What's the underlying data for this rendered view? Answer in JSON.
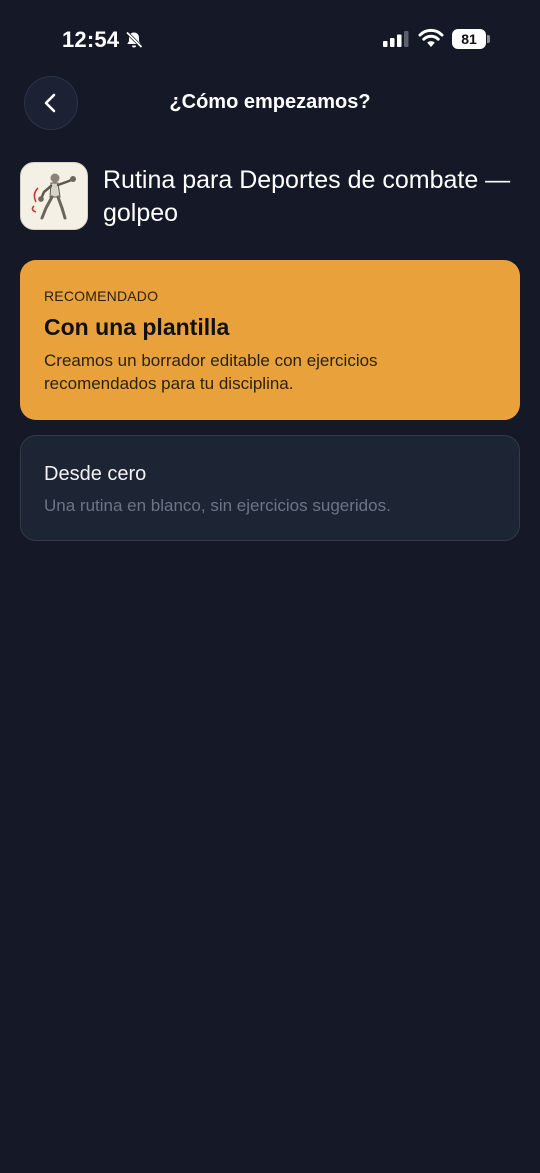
{
  "status_bar": {
    "time": "12:54",
    "battery": "81",
    "icons": [
      "bell-muted-icon",
      "signal-icon",
      "wifi-icon",
      "battery-icon"
    ]
  },
  "header": {
    "title": "¿Cómo empezamos?",
    "back_icon": "chevron-left-icon"
  },
  "routine": {
    "title": "Rutina para Deportes de combate — golpeo",
    "thumbnail_icon": "boxer-illustration-icon"
  },
  "options": {
    "template": {
      "eyebrow": "RECOMENDADO",
      "title": "Con una plantilla",
      "description": "Creamos un borrador editable con ejercicios recomendados para tu disciplina."
    },
    "scratch": {
      "title": "Desde cero",
      "description": "Una rutina en blanco, sin ejercicios sugeridos."
    }
  },
  "colors": {
    "background": "#141827",
    "accent": "#e9a23b",
    "card_dark": "#1d2433",
    "muted_text": "#6d7487"
  }
}
